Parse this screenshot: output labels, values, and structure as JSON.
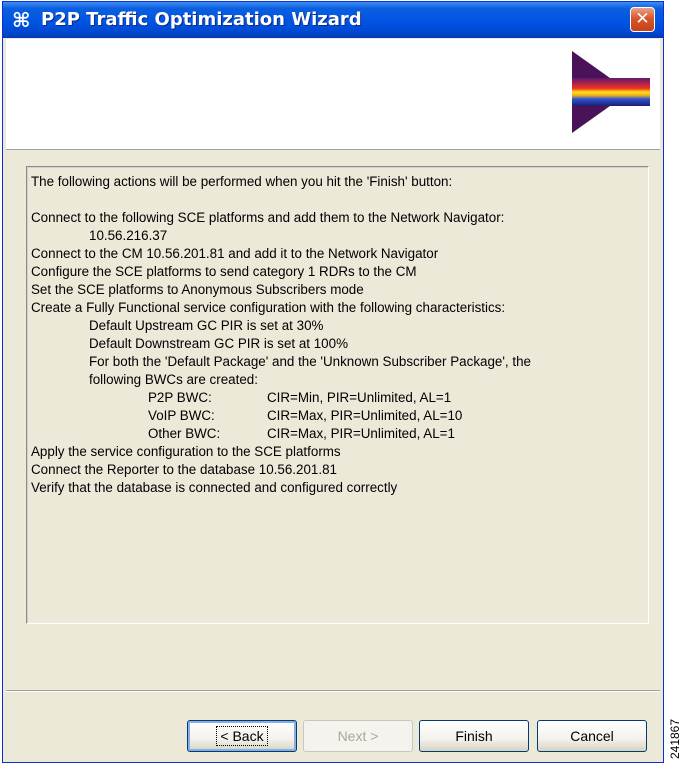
{
  "window": {
    "title": "P2P Traffic Optimization Wizard",
    "app_icon": "⌘",
    "close_icon": "✕"
  },
  "summary_lines": [
    "The following actions will be performed when you hit the 'Finish' button:",
    "Connect to the following SCE platforms and add them to the Network Navigator:",
    "10.56.216.37",
    "Connect to the CM 10.56.201.81 and add it to the Network Navigator",
    "Configure the SCE platforms to send category 1 RDRs to the CM",
    "Set the SCE platforms to Anonymous Subscribers mode",
    "Create a Fully Functional service configuration with the following characteristics:",
    "Default Upstream GC PIR is set at 30%",
    "Default Downstream GC PIR is set at 100%",
    "For both the 'Default Package' and the 'Unknown Subscriber Package', the",
    "following BWCs are created:",
    "Apply the service configuration to the SCE platforms",
    "Connect the Reporter to the database 10.56.201.81",
    "Verify that the database is connected and configured correctly"
  ],
  "bwc_rows": [
    {
      "name": "P2P BWC:",
      "settings": "CIR=Min, PIR=Unlimited, AL=1"
    },
    {
      "name": "VoIP BWC:",
      "settings": "CIR=Max, PIR=Unlimited, AL=10"
    },
    {
      "name": "Other BWC:",
      "settings": "CIR=Max, PIR=Unlimited, AL=1"
    }
  ],
  "buttons": {
    "back": "< Back",
    "next": "Next >",
    "finish": "Finish",
    "cancel": "Cancel"
  },
  "figure_id": "241867"
}
